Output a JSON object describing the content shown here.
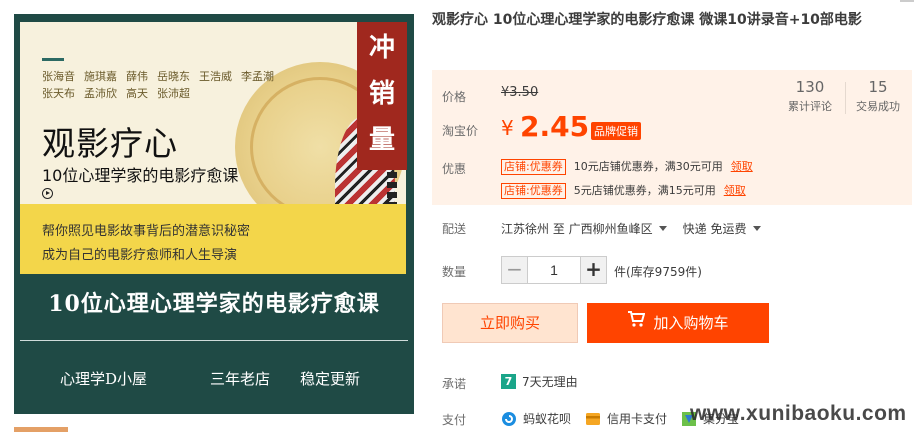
{
  "gallery": {
    "names_line1": [
      "张海音",
      "施琪嘉",
      "薛伟",
      "岳晓东",
      "王浩威",
      "李孟潮"
    ],
    "names_line2": [
      "张天布",
      "孟沛欣",
      "高天",
      "张沛超"
    ],
    "main_title": "观影疗心",
    "sub_title": "10位心理学家的电影疗愈课",
    "band_line1": "帮你照见电影故事背后的潜意识秘密",
    "band_line2": "成为自己的电影疗愈师和人生导演",
    "stamp_text": [
      "冲",
      "销",
      "量"
    ],
    "bottom_title": "10位心理心理学家的电影疗愈课",
    "tags": [
      "心理学D小屋",
      "三年老店",
      "稳定更新"
    ]
  },
  "product": {
    "title": "观影疗心 10位心理心理学家的电影疗愈课 微课10讲录音+10部电影"
  },
  "price": {
    "label": "价格",
    "original": "¥3.50",
    "taobao_label": "淘宝价",
    "currency": "¥",
    "current": "2.45",
    "promo_badge": "品牌促销",
    "reviews_count": "130",
    "reviews_label": "累计评论",
    "deals_count": "15",
    "deals_label": "交易成功"
  },
  "coupons": {
    "label": "优惠",
    "items": [
      {
        "tag": "店铺:优惠券",
        "text": "10元店铺优惠券，满30元可用",
        "link": "领取"
      },
      {
        "tag": "店铺:优惠券",
        "text": "5元店铺优惠券，满15元可用",
        "link": "领取"
      }
    ]
  },
  "delivery": {
    "label": "配送",
    "from": "江苏徐州 至",
    "to": "广西柳州鱼峰区",
    "method": "快递 免运费"
  },
  "quantity": {
    "label": "数量",
    "value": "1",
    "unit": "件(库存9759件)"
  },
  "actions": {
    "buy_now": "立即购买",
    "add_to_cart": "加入购物车"
  },
  "promise": {
    "label": "承诺",
    "icon_text": "7",
    "text": "7天无理由"
  },
  "payment": {
    "label": "支付",
    "methods": [
      "蚂蚁花呗",
      "信用卡支付",
      "集分宝"
    ]
  },
  "watermark": "www.xunibaoku.com",
  "colors": {
    "accent": "#ff4400",
    "price_panel_bg": "#fff2e8",
    "gallery_bg": "#1f4a45",
    "stamp_red": "#a0281e",
    "promise_green": "#1aa589"
  }
}
